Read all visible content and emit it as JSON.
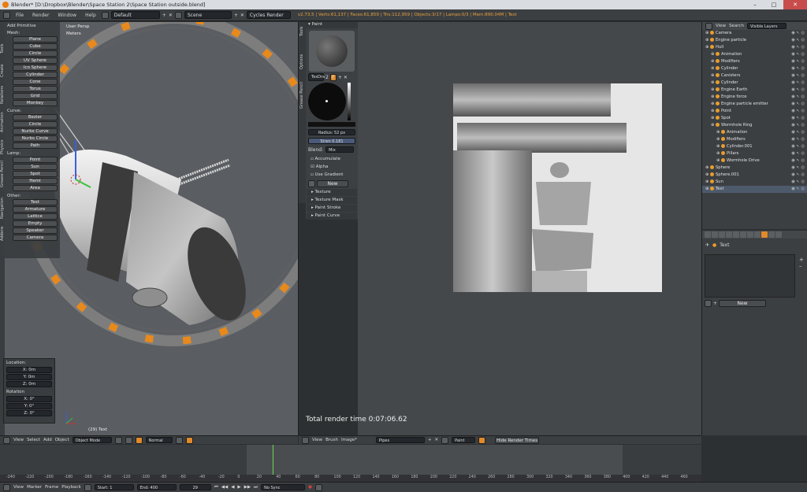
{
  "titlebar": {
    "title": "Blender* [D:\\Dropbox\\Blender\\Space Station 2\\Space Station outside.blend]"
  },
  "topbar": {
    "menus": [
      "File",
      "Render",
      "Window",
      "Help"
    ],
    "layout": "Default",
    "scene": "Scene",
    "engine": "Cycles Render",
    "stats": "v2.73.5 | Verts:61,137 | Faces:61,859 | Tris:112,959 | Objects:3/17 | Lamps:0/3 | Mem:890.04M | Text"
  },
  "viewport": {
    "view_name": "User Persp",
    "units": "Meters",
    "object_label": "(29) Text",
    "tabs": [
      "Tools",
      "Create",
      "Relations",
      "Animation",
      "Physics",
      "Grease Pencil",
      "Navigation",
      "Addons"
    ],
    "shelf_title": "Add Primitive",
    "mesh_label": "Mesh:",
    "mesh_items": [
      "Plane",
      "Cube",
      "Circle",
      "UV Sphere",
      "Ico Sphere",
      "Cylinder",
      "Cone",
      "Torus",
      "Grid",
      "Monkey"
    ],
    "curve_label": "Curve:",
    "curve_items": [
      "Bezier",
      "Circle",
      "Nurbs Curve",
      "Nurbs Circle",
      "Path"
    ],
    "lamp_label": "Lamp:",
    "lamp_items": [
      "Point",
      "Sun",
      "Spot",
      "Hemi",
      "Area"
    ],
    "other_label": "Other:",
    "other_items": [
      "Text",
      "Armature",
      "Lattice",
      "Empty",
      "Speaker",
      "Camera"
    ],
    "location_label": "Location:",
    "location": {
      "x": "X:",
      "x_val": "0m",
      "y": "Y:",
      "y_val": "0m",
      "z": "Z:",
      "z_val": "0m"
    },
    "rotation_label": "Rotation",
    "rotation": {
      "x": "X:",
      "x_val": "0°",
      "y": "Y:",
      "y_val": "0°",
      "z": "Z:",
      "z_val": "0°"
    },
    "header": {
      "view": "View",
      "select": "Select",
      "add": "Add",
      "object": "Object",
      "mode": "Object Mode",
      "pivot": "Normal"
    }
  },
  "paint": {
    "tabs": [
      "Tools",
      "Options",
      "Grease Pencil"
    ],
    "title": "Paint",
    "brush_name": "TexDra",
    "brush_num": "2",
    "brush_f": "F",
    "radius": "Radius:      52 px",
    "strength": "Stren 0.181",
    "blend_label": "Blend:",
    "blend_value": "Mix",
    "accumulate": "Accumulate",
    "alpha": "Alpha",
    "use_gradient": "Use Gradient",
    "new_label": "New",
    "sections": [
      "Texture",
      "Texture Mask",
      "Paint Stroke",
      "Paint Curve"
    ]
  },
  "image_editor": {
    "render_time": "Total render time 0:07:06.62",
    "header": {
      "view": "View",
      "brush": "Brush",
      "image": "Image*",
      "image_name": "Pipes",
      "paint_mode": "Paint",
      "hide_label": "Hide Render Times"
    }
  },
  "outliner": {
    "view": "View",
    "search": "Search",
    "filter": "Visible Layers",
    "rows": [
      {
        "label": "Camera",
        "indent": 0
      },
      {
        "label": "Engine particle",
        "indent": 0
      },
      {
        "label": "Hull",
        "indent": 0
      },
      {
        "label": "Animation",
        "indent": 1
      },
      {
        "label": "Modifiers",
        "indent": 1
      },
      {
        "label": "Cylinder",
        "indent": 1
      },
      {
        "label": "Canisters",
        "indent": 1
      },
      {
        "label": "Cylinder",
        "indent": 1
      },
      {
        "label": "Engine Earth",
        "indent": 1
      },
      {
        "label": "Engine force",
        "indent": 1
      },
      {
        "label": "Engine particle emitter",
        "indent": 1
      },
      {
        "label": "Point",
        "indent": 1
      },
      {
        "label": "Spot",
        "indent": 1
      },
      {
        "label": "Wormhole Ring",
        "indent": 1
      },
      {
        "label": "Animation",
        "indent": 2
      },
      {
        "label": "Modifiers",
        "indent": 2
      },
      {
        "label": "Cylinder.001",
        "indent": 2
      },
      {
        "label": "Pillars",
        "indent": 2
      },
      {
        "label": "Wormhole Drive",
        "indent": 2
      },
      {
        "label": "Sphere",
        "indent": 0
      },
      {
        "label": "Sphere.001",
        "indent": 0
      },
      {
        "label": "Sun",
        "indent": 0
      },
      {
        "label": "Text",
        "indent": 0
      }
    ]
  },
  "properties": {
    "object_name": "Text",
    "new_label": "New"
  },
  "timeline": {
    "menus": [
      "View",
      "Marker",
      "Frame",
      "Playback"
    ],
    "start": "Start:           1",
    "end": "End:           400",
    "current": "29",
    "sync": "No Sync",
    "ruler": [
      "-240",
      "-220",
      "-200",
      "-180",
      "-160",
      "-140",
      "-120",
      "-100",
      "-80",
      "-60",
      "-40",
      "-20",
      "0",
      "20",
      "40",
      "60",
      "80",
      "100",
      "120",
      "140",
      "160",
      "180",
      "200",
      "220",
      "240",
      "260",
      "280",
      "300",
      "320",
      "340",
      "360",
      "380",
      "400",
      "420",
      "440",
      "460"
    ]
  }
}
